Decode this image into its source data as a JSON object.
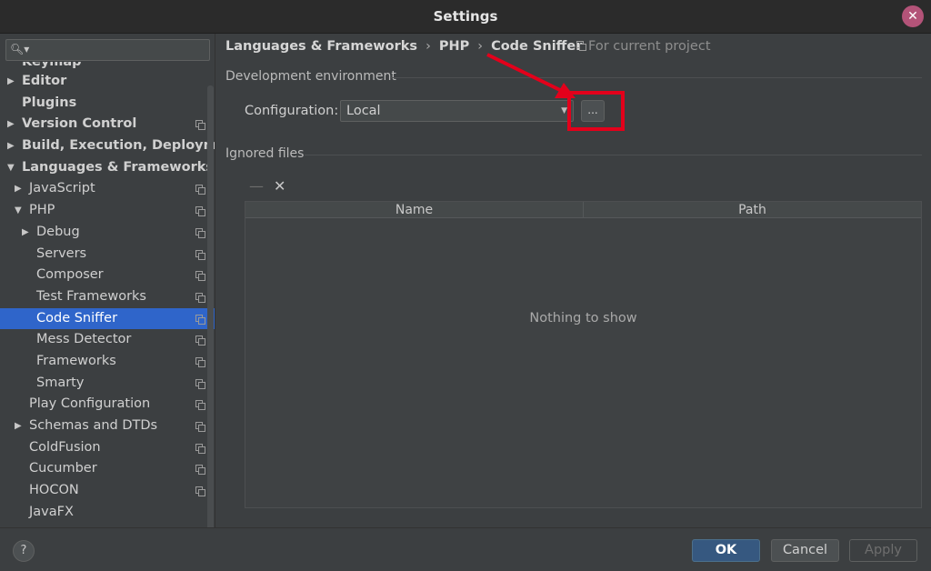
{
  "window": {
    "title": "Settings"
  },
  "sidebar": {
    "search_placeholder": "",
    "items": [
      {
        "label": "Keymap",
        "indent": 0,
        "bold": true,
        "arrow": "",
        "copy": false,
        "selected": false,
        "partial": true
      },
      {
        "label": "Editor",
        "indent": 0,
        "bold": true,
        "arrow": "▶",
        "copy": false,
        "selected": false
      },
      {
        "label": "Plugins",
        "indent": 0,
        "bold": true,
        "arrow": "",
        "copy": false,
        "selected": false
      },
      {
        "label": "Version Control",
        "indent": 0,
        "bold": true,
        "arrow": "▶",
        "copy": true,
        "selected": false
      },
      {
        "label": "Build, Execution, Deployment",
        "indent": 0,
        "bold": true,
        "arrow": "▶",
        "copy": false,
        "selected": false
      },
      {
        "label": "Languages & Frameworks",
        "indent": 0,
        "bold": true,
        "arrow": "▼",
        "copy": false,
        "selected": false
      },
      {
        "label": "JavaScript",
        "indent": 1,
        "bold": false,
        "arrow": "▶",
        "copy": true,
        "selected": false
      },
      {
        "label": "PHP",
        "indent": 1,
        "bold": false,
        "arrow": "▼",
        "copy": true,
        "selected": false
      },
      {
        "label": "Debug",
        "indent": 2,
        "bold": false,
        "arrow": "▶",
        "copy": true,
        "selected": false
      },
      {
        "label": "Servers",
        "indent": 2,
        "bold": false,
        "arrow": "",
        "copy": true,
        "selected": false
      },
      {
        "label": "Composer",
        "indent": 2,
        "bold": false,
        "arrow": "",
        "copy": true,
        "selected": false
      },
      {
        "label": "Test Frameworks",
        "indent": 2,
        "bold": false,
        "arrow": "",
        "copy": true,
        "selected": false
      },
      {
        "label": "Code Sniffer",
        "indent": 2,
        "bold": false,
        "arrow": "",
        "copy": true,
        "selected": true
      },
      {
        "label": "Mess Detector",
        "indent": 2,
        "bold": false,
        "arrow": "",
        "copy": true,
        "selected": false
      },
      {
        "label": "Frameworks",
        "indent": 2,
        "bold": false,
        "arrow": "",
        "copy": true,
        "selected": false
      },
      {
        "label": "Smarty",
        "indent": 2,
        "bold": false,
        "arrow": "",
        "copy": true,
        "selected": false
      },
      {
        "label": "Play Configuration",
        "indent": 1,
        "bold": false,
        "arrow": "",
        "copy": true,
        "selected": false
      },
      {
        "label": "Schemas and DTDs",
        "indent": 1,
        "bold": false,
        "arrow": "▶",
        "copy": true,
        "selected": false
      },
      {
        "label": "ColdFusion",
        "indent": 1,
        "bold": false,
        "arrow": "",
        "copy": true,
        "selected": false
      },
      {
        "label": "Cucumber",
        "indent": 1,
        "bold": false,
        "arrow": "",
        "copy": true,
        "selected": false
      },
      {
        "label": "HOCON",
        "indent": 1,
        "bold": false,
        "arrow": "",
        "copy": true,
        "selected": false
      },
      {
        "label": "JavaFX",
        "indent": 1,
        "bold": false,
        "arrow": "",
        "copy": false,
        "selected": false
      }
    ]
  },
  "breadcrumb": {
    "items": [
      "Languages & Frameworks",
      "PHP",
      "Code Sniffer"
    ],
    "separator": "›"
  },
  "scope": {
    "label": "For current project"
  },
  "dev_env": {
    "title": "Development environment",
    "config_label": "Configuration:",
    "config_value": "Local",
    "ellipsis_label": "..."
  },
  "ignored": {
    "title": "Ignored files",
    "remove_label": "—",
    "clear_label": "✕",
    "columns": [
      "Name",
      "Path"
    ],
    "empty_text": "Nothing to show"
  },
  "buttons": {
    "help": "?",
    "ok": "OK",
    "cancel": "Cancel",
    "apply": "Apply"
  },
  "colors": {
    "highlight": "#e3001b",
    "selected": "#2f65ca",
    "ok": "#365880",
    "close": "#b35378"
  }
}
